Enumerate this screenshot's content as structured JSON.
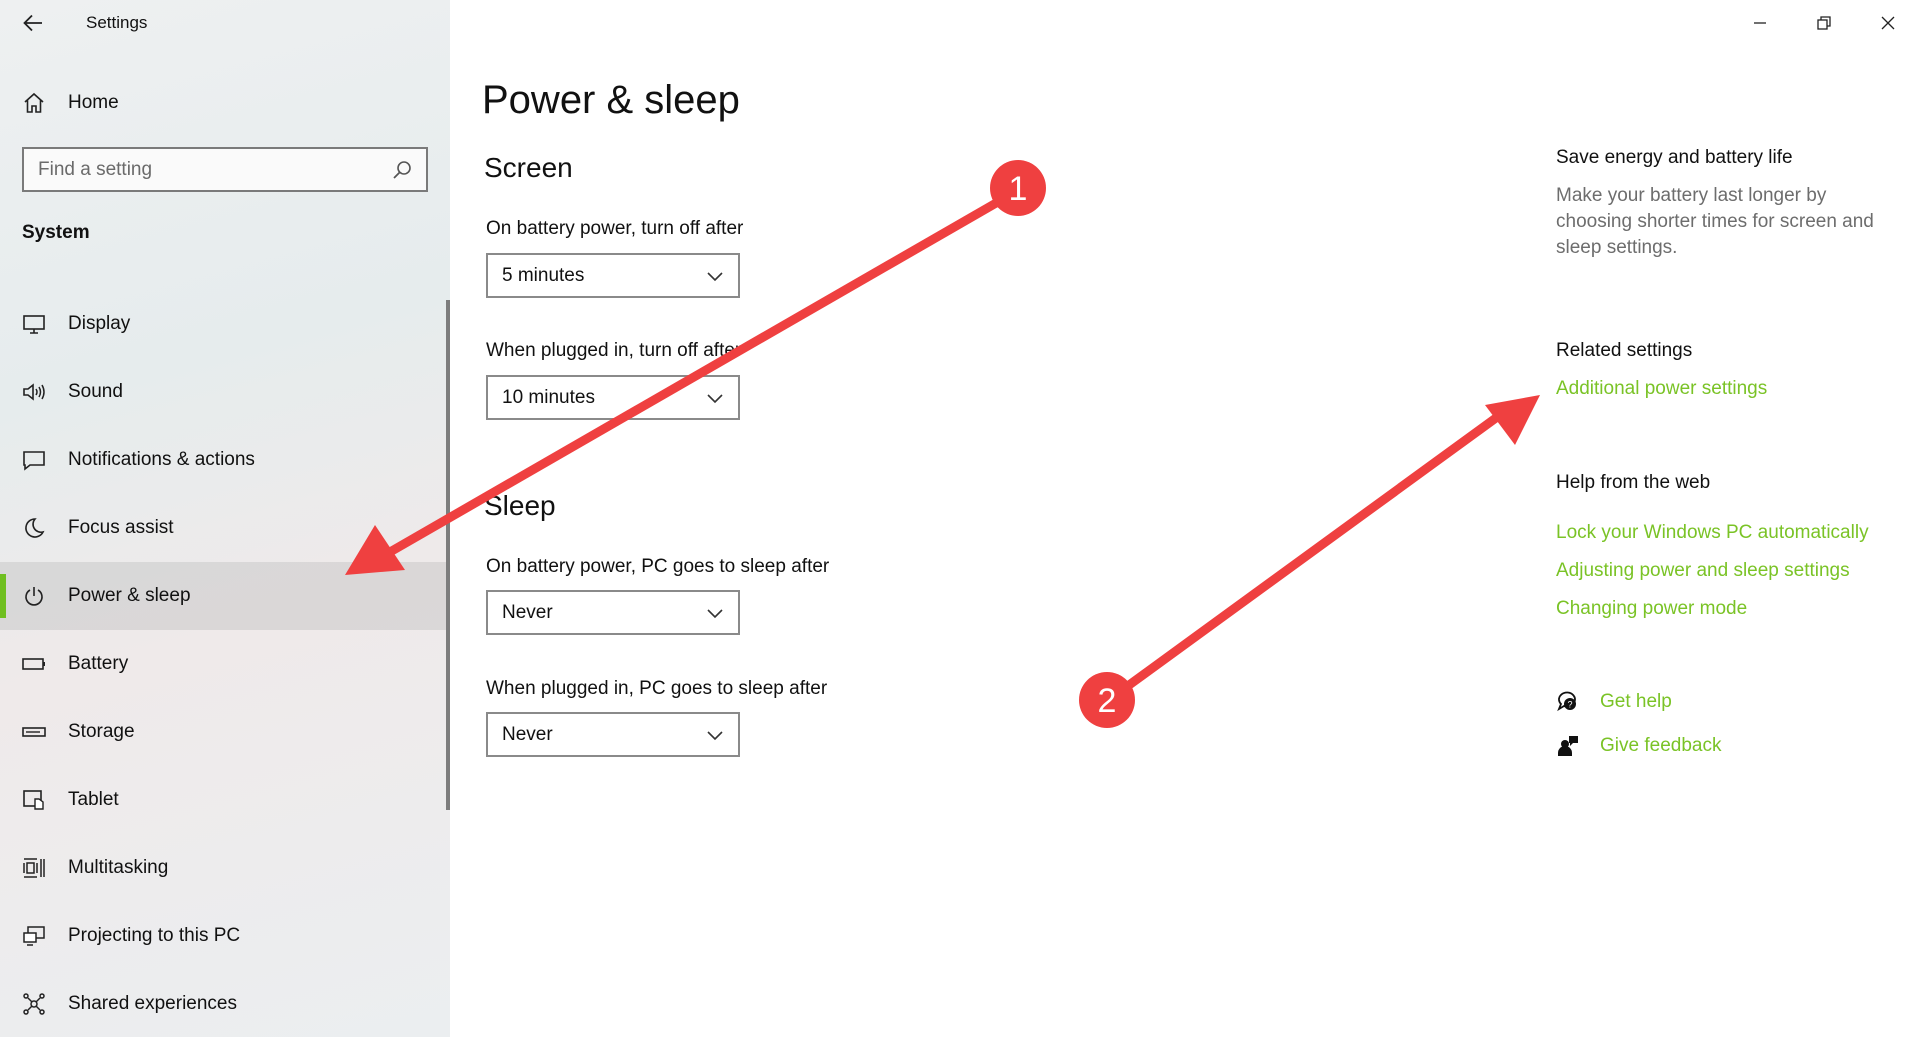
{
  "window": {
    "title": "Settings",
    "controls": {
      "minimize": "minimize-icon",
      "restore": "restore-icon",
      "close": "close-icon"
    }
  },
  "sidebar": {
    "home_label": "Home",
    "search_placeholder": "Find a setting",
    "section": "System",
    "items": [
      {
        "label": "Display",
        "icon": "monitor-icon"
      },
      {
        "label": "Sound",
        "icon": "speaker-icon"
      },
      {
        "label": "Notifications & actions",
        "icon": "notification-icon"
      },
      {
        "label": "Focus assist",
        "icon": "moon-icon"
      },
      {
        "label": "Power & sleep",
        "icon": "power-icon",
        "active": true
      },
      {
        "label": "Battery",
        "icon": "battery-icon"
      },
      {
        "label": "Storage",
        "icon": "storage-icon"
      },
      {
        "label": "Tablet",
        "icon": "tablet-icon"
      },
      {
        "label": "Multitasking",
        "icon": "multitasking-icon"
      },
      {
        "label": "Projecting to this PC",
        "icon": "projecting-icon"
      },
      {
        "label": "Shared experiences",
        "icon": "shared-icon"
      }
    ]
  },
  "main": {
    "title": "Power & sleep",
    "screen": {
      "heading": "Screen",
      "battery_label": "On battery power, turn off after",
      "battery_value": "5 minutes",
      "plugged_label": "When plugged in, turn off after",
      "plugged_value": "10 minutes"
    },
    "sleep": {
      "heading": "Sleep",
      "battery_label": "On battery power, PC goes to sleep after",
      "battery_value": "Never",
      "plugged_label": "When plugged in, PC goes to sleep after",
      "plugged_value": "Never"
    }
  },
  "right": {
    "save_heading": "Save energy and battery life",
    "save_text": "Make your battery last longer by choosing shorter times for screen and sleep settings.",
    "related_heading": "Related settings",
    "related_link": "Additional power settings",
    "help_heading": "Help from the web",
    "help_links": [
      "Lock your Windows PC automatically",
      "Adjusting power and sleep settings",
      "Changing power mode"
    ],
    "get_help": "Get help",
    "give_feedback": "Give feedback"
  },
  "annotations": {
    "badge_1": "1",
    "badge_2": "2",
    "color": "#ef4040"
  },
  "colors": {
    "accent": "#7ac326",
    "active_indicator": "#6fbf20"
  }
}
